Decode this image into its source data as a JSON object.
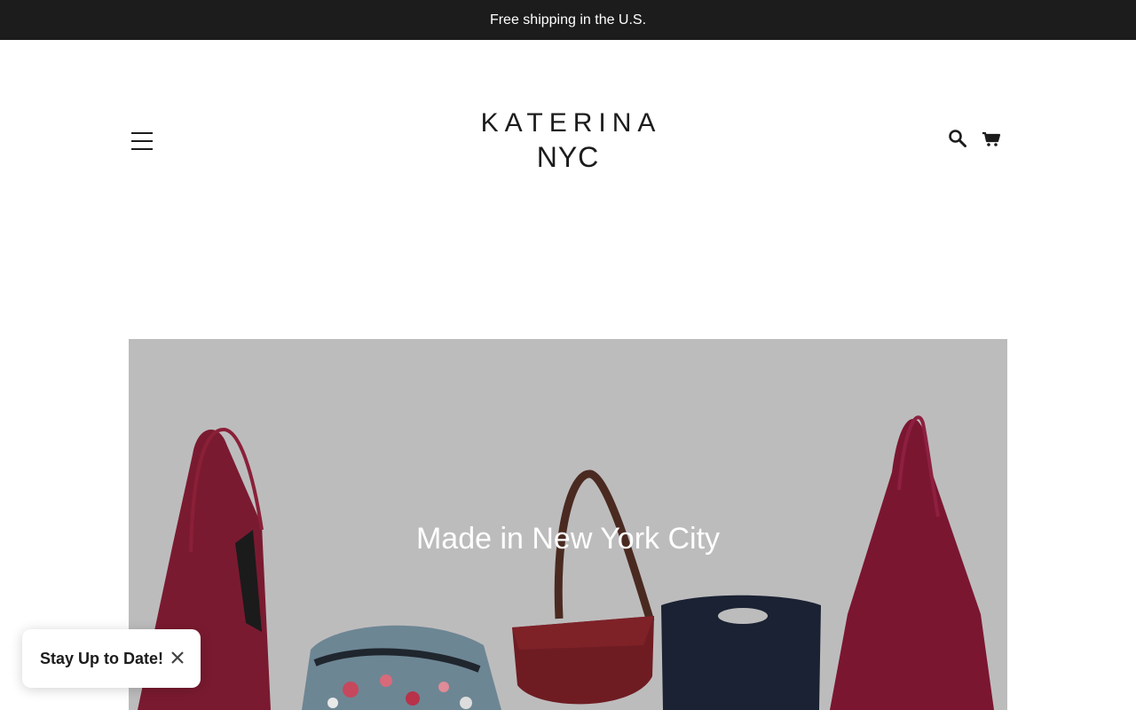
{
  "announcement": {
    "text": "Free shipping in the U.S."
  },
  "header": {
    "logo_line1": "KATERINA",
    "logo_line2": "NYC",
    "menu_icon": "hamburger-icon",
    "search_icon": "search-icon",
    "cart_icon": "cart-icon"
  },
  "hero": {
    "title": "Made in New York City",
    "background_color": "#bdbcbd"
  },
  "popup": {
    "label": "Stay Up to Date!",
    "close_icon": "close-icon"
  },
  "colors": {
    "announcement_bar": "#1c1c1c",
    "text": "#1c1c1c",
    "burgundy": "#7b1630",
    "navy": "#1a2233"
  }
}
